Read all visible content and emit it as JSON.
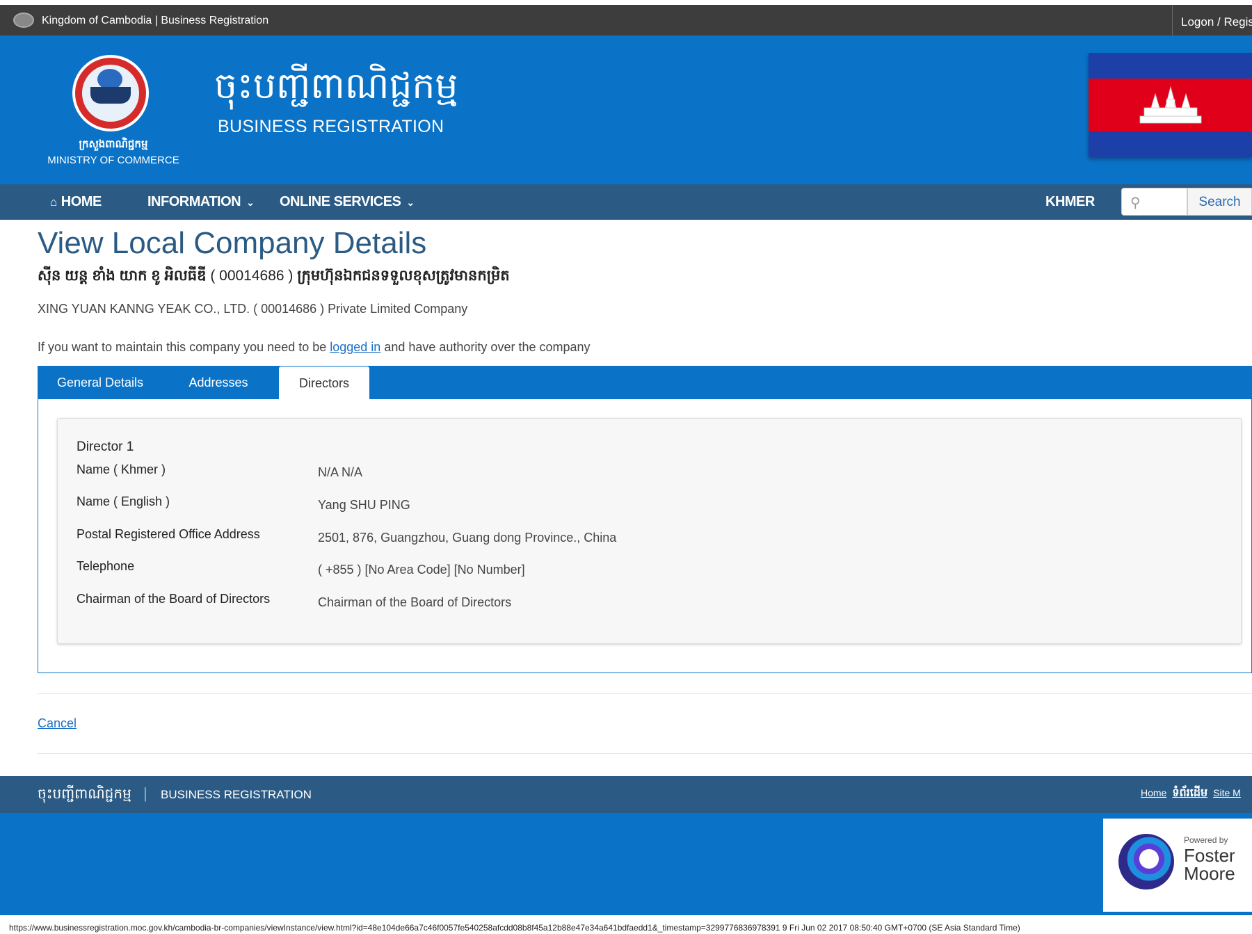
{
  "topbar": {
    "site_label": "Kingdom of Cambodia | Business Registration",
    "logon_label": "Logon / Regist"
  },
  "header": {
    "ministry_kh": "ក្រសួងពាណិជ្ជកម្ម",
    "ministry_en": "MINISTRY OF COMMERCE",
    "title_kh": "ចុះបញ្ជីពាណិជ្ជកម្ម",
    "title_en": "BUSINESS REGISTRATION"
  },
  "nav": {
    "home": "HOME",
    "information": "INFORMATION",
    "online_services": "ONLINE SERVICES",
    "language": "KHMER",
    "search_button": "Search",
    "search_placeholder": ""
  },
  "page": {
    "title": "View Local Company Details",
    "company_name_kh": "ស៊ីន យន្ត ខាំង យាក ខូ អិលធីឌី",
    "company_number_kh": "( 00014686 )",
    "company_type_kh": "ក្រុមហ៊ុនឯកជនទទួលខុសត្រូវមានកម្រិត",
    "company_line_en": "XING YUAN KANNG YEAK CO., LTD. ( 00014686 ) Private Limited Company",
    "maintain_prefix": "If you want to maintain this company you need to be ",
    "maintain_link": "logged in",
    "maintain_suffix": " and have authority over the company"
  },
  "tabs": [
    {
      "label": "General Details",
      "active": false
    },
    {
      "label": "Addresses",
      "active": false
    },
    {
      "label": "Directors",
      "active": true
    }
  ],
  "director": {
    "heading": "Director 1",
    "fields": [
      {
        "label": "Name ( Khmer )",
        "value": "N/A N/A"
      },
      {
        "label": "Name ( English )",
        "value": "Yang SHU PING"
      },
      {
        "label": "Postal Registered Office Address",
        "value": "2501, 876, Guangzhou, Guang dong Province., China"
      },
      {
        "label": "Telephone",
        "value": "( +855 ) [No Area Code] [No Number]"
      },
      {
        "label": "Chairman of the Board of Directors",
        "value": "Chairman of the Board of Directors"
      }
    ]
  },
  "actions": {
    "cancel": "Cancel"
  },
  "footer": {
    "title_kh": "ចុះបញ្ជីពាណិជ្ជកម្ម",
    "separator": "|",
    "title_en": "BUSINESS REGISTRATION",
    "link_home": "Home",
    "link_home_kh": "ទំព័រដើម",
    "link_sitemap": "Site M",
    "powered_by": "Powered by",
    "vendor_line1": "Foster",
    "vendor_line2": "Moore"
  },
  "statusbar": {
    "text": "https://www.businessregistration.moc.gov.kh/cambodia-br-companies/viewInstance/view.html?id=48e104de66a7c46f0057fe540258afcdd08b8f45a12b88e47e34a641bdfaedd1&_timestamp=3299776836978391 9 Fri Jun 02 2017 08:50:40 GMT+0700 (SE Asia Standard Time)"
  },
  "colors": {
    "primary_blue": "#0a73c7",
    "nav_dark": "#2b5b84",
    "topbar": "#3d3d3d",
    "flag_blue": "#1d3fa8",
    "flag_red": "#e0001a"
  }
}
